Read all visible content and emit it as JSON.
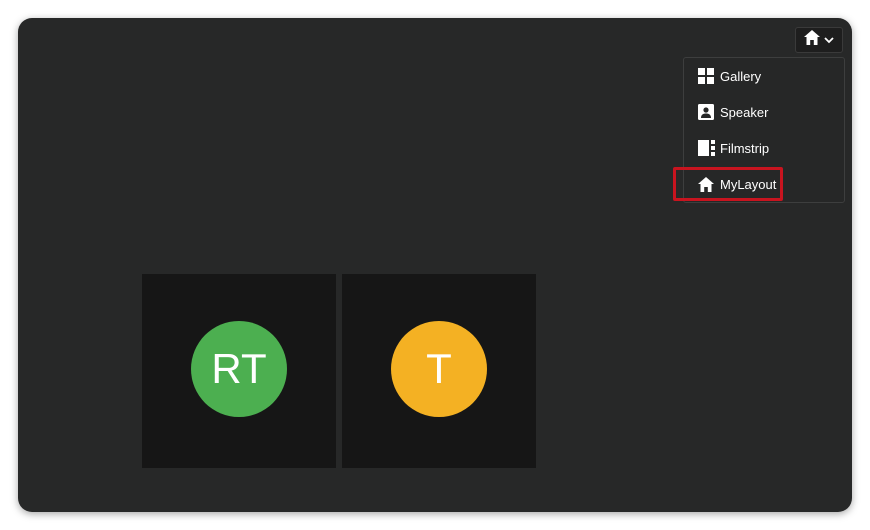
{
  "layout_toggle": {
    "icon": "home-icon",
    "chevron": "chevron-down-icon"
  },
  "menu": {
    "items": [
      {
        "label": "Gallery",
        "icon": "gallery-grid-icon"
      },
      {
        "label": "Speaker",
        "icon": "speaker-portrait-icon"
      },
      {
        "label": "Filmstrip",
        "icon": "filmstrip-icon"
      },
      {
        "label": "MyLayout",
        "icon": "home-icon",
        "highlighted": true
      }
    ]
  },
  "participants": [
    {
      "initials": "RT",
      "color": "#4caf50"
    },
    {
      "initials": "T",
      "color": "#f4b123"
    }
  ],
  "colors": {
    "window_bg": "#272828",
    "tile_bg": "#161616",
    "highlight": "#c8141f"
  }
}
